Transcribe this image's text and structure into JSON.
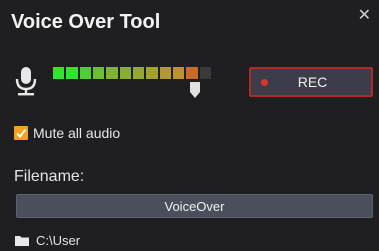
{
  "window": {
    "title": "Voice Over Tool",
    "close_glyph": "✕"
  },
  "meter": {
    "icon": "microphone-icon",
    "segment_colors": [
      "#2ee62e",
      "#2ee62e",
      "#4fcf2f",
      "#6bbf30",
      "#7eb530",
      "#8aae30",
      "#94a830",
      "#a3a12f",
      "#b39a2f",
      "#c08f2e",
      "#cc6a2a",
      "#b42a24"
    ],
    "level_fraction": 0.92,
    "slider_fraction": 0.9
  },
  "record": {
    "label": "REC",
    "accent": "#b12a2a",
    "dot_color": "#e03131"
  },
  "options": {
    "mute_label": "Mute all audio",
    "mute_checked": true,
    "check_color": "#f4a020"
  },
  "file": {
    "filename_label": "Filename:",
    "filename_value": "VoiceOver",
    "path_icon": "folder-icon",
    "path": "C:\\User"
  }
}
